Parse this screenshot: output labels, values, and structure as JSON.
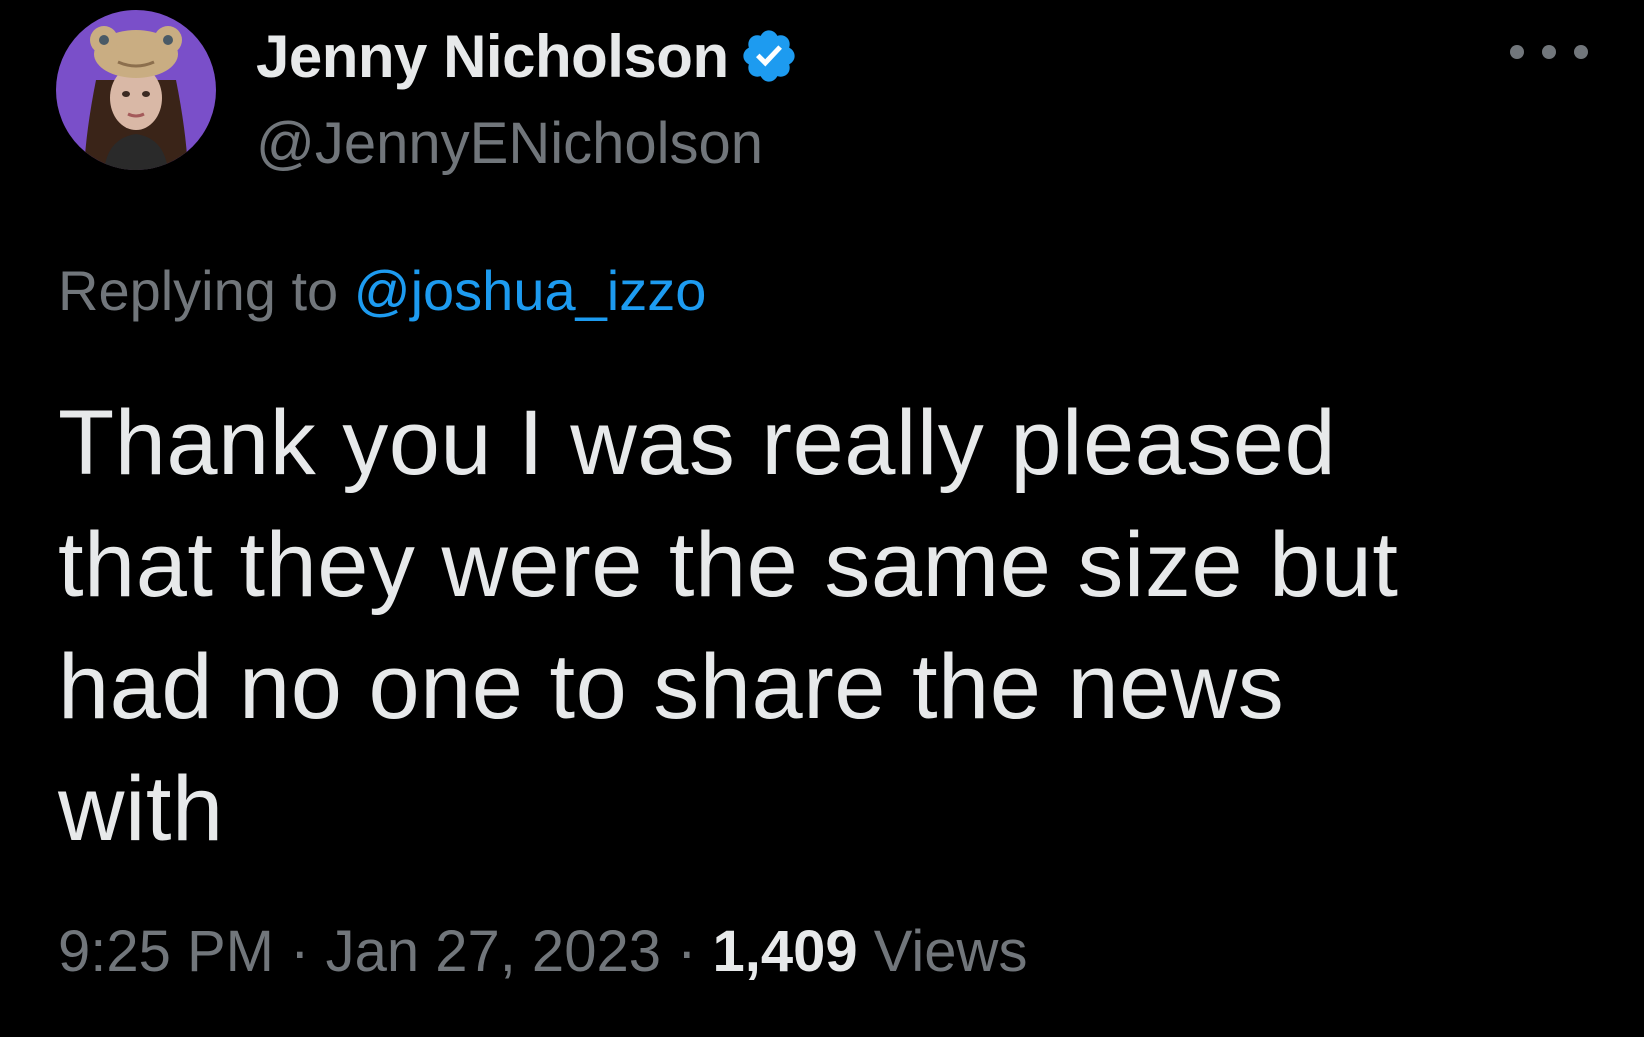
{
  "author": {
    "display_name": "Jenny Nicholson",
    "handle": "@JennyENicholson",
    "verified": true,
    "avatar_icon": "profile-photo",
    "verified_icon": "verified-badge-icon"
  },
  "more_icon": "more-options-icon",
  "reply": {
    "prefix": "Replying to",
    "target": "@joshua_izzo"
  },
  "tweet": {
    "lines": [
      "Thank you I was really pleased",
      "that they were the same size but",
      "had no one to share the news",
      "with"
    ]
  },
  "meta": {
    "time": "9:25 PM",
    "separator": "·",
    "date": "Jan 27, 2023",
    "views_count": "1,409",
    "views_label": "Views"
  },
  "colors": {
    "background": "#000000",
    "primary_text": "#e7e9ea",
    "secondary_text": "#71767b",
    "link": "#1d9bf0",
    "avatar_bg": "#7a4fc9"
  }
}
